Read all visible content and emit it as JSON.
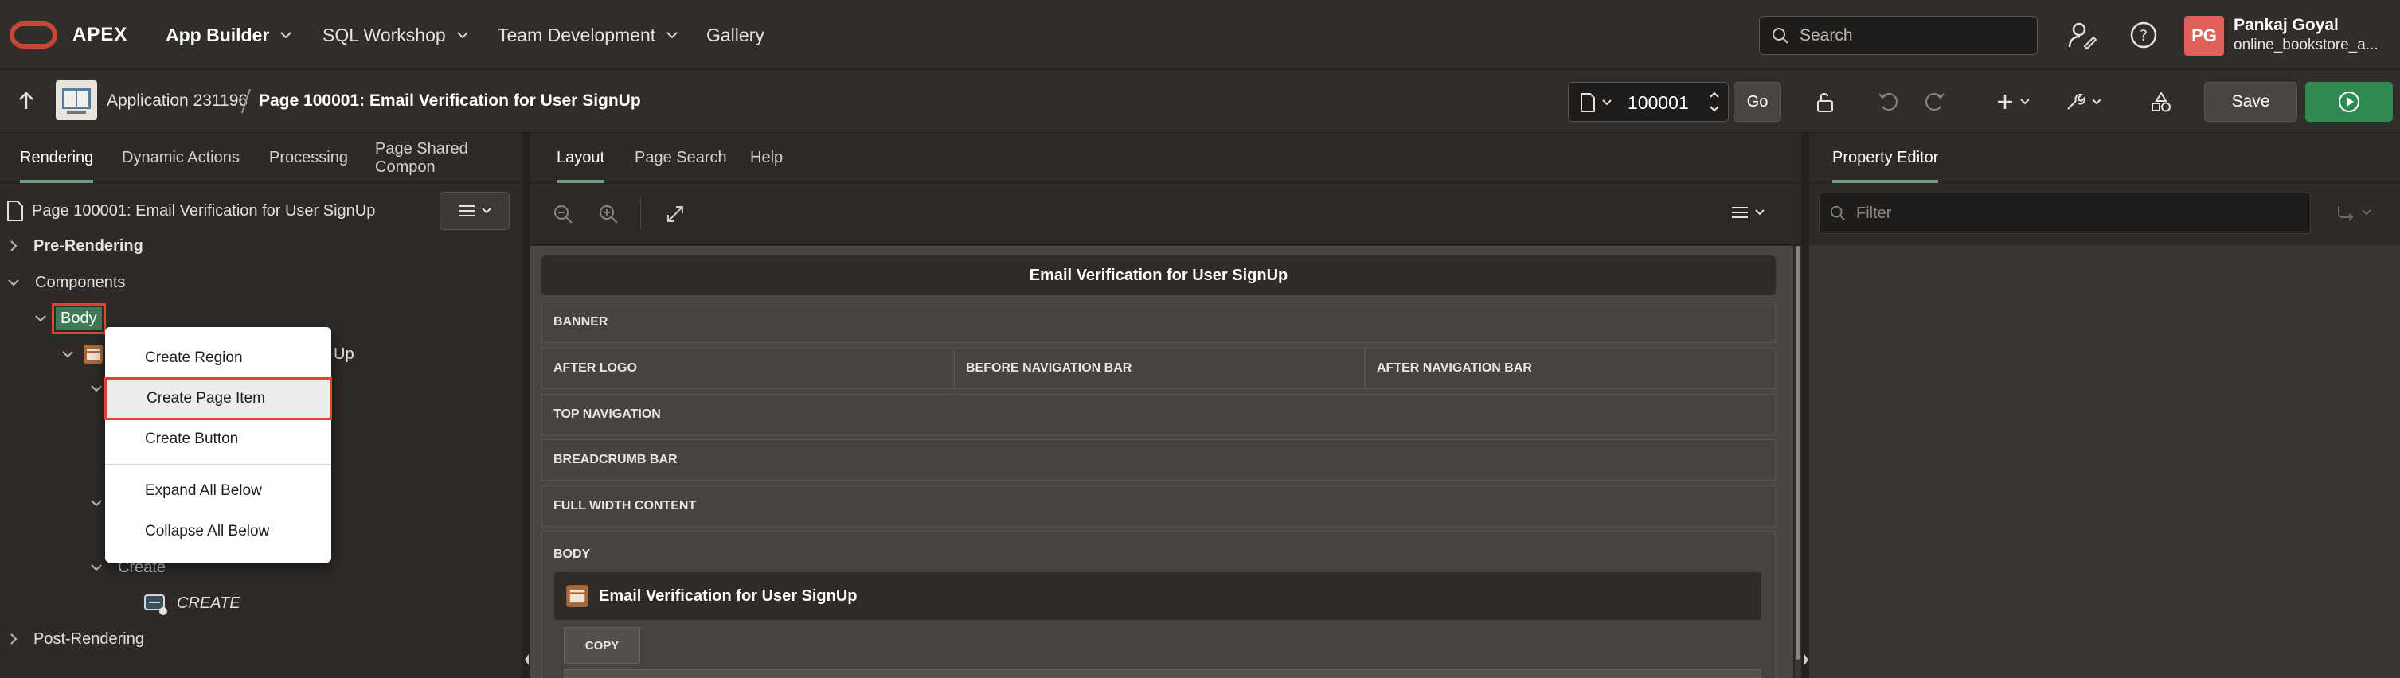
{
  "topnav": {
    "logo_text": "APEX",
    "menus": [
      "App Builder",
      "SQL Workshop",
      "Team Development",
      "Gallery"
    ],
    "search_placeholder": "Search",
    "user_initials": "PG",
    "user_name": "Pankaj Goyal",
    "user_workspace": "online_bookstore_a...",
    "colors": {
      "brand": "#c74634",
      "avatar": "#e0605a"
    }
  },
  "toolbar": {
    "app_label": "Application 231196",
    "page_title": "Page 100001: Email Verification for User SignUp",
    "page_number": "100001",
    "go_label": "Go",
    "save_label": "Save",
    "colors": {
      "run": "#2f8a52"
    }
  },
  "left": {
    "tabs": [
      "Rendering",
      "Dynamic Actions",
      "Processing",
      "Page Shared Compon"
    ],
    "page_node": "Page 100001: Email Verification for User SignUp",
    "tree": {
      "pre_rendering": "Pre-Rendering",
      "components": "Components",
      "body": "Body",
      "region_suffix": "Up",
      "create_group": "Create",
      "create_button": "CREATE",
      "post_rendering": "Post-Rendering"
    }
  },
  "context_menu": {
    "items": [
      "Create Region",
      "Create Page Item",
      "Create Button",
      "Expand All Below",
      "Collapse All Below"
    ],
    "highlighted": "Create Page Item"
  },
  "center": {
    "tabs": [
      "Layout",
      "Page Search",
      "Help"
    ],
    "layout_title": "Email Verification for User SignUp",
    "positions": {
      "banner": "BANNER",
      "after_logo": "AFTER LOGO",
      "before_nav": "BEFORE NAVIGATION BAR",
      "after_nav": "AFTER NAVIGATION BAR",
      "top_nav": "TOP NAVIGATION",
      "breadcrumb": "BREADCRUMB BAR",
      "full_width": "FULL WIDTH CONTENT",
      "body": "BODY"
    },
    "region_title": "Email Verification for User SignUp",
    "copy_label": "COPY"
  },
  "right": {
    "tab": "Property Editor",
    "filter_placeholder": "Filter"
  }
}
